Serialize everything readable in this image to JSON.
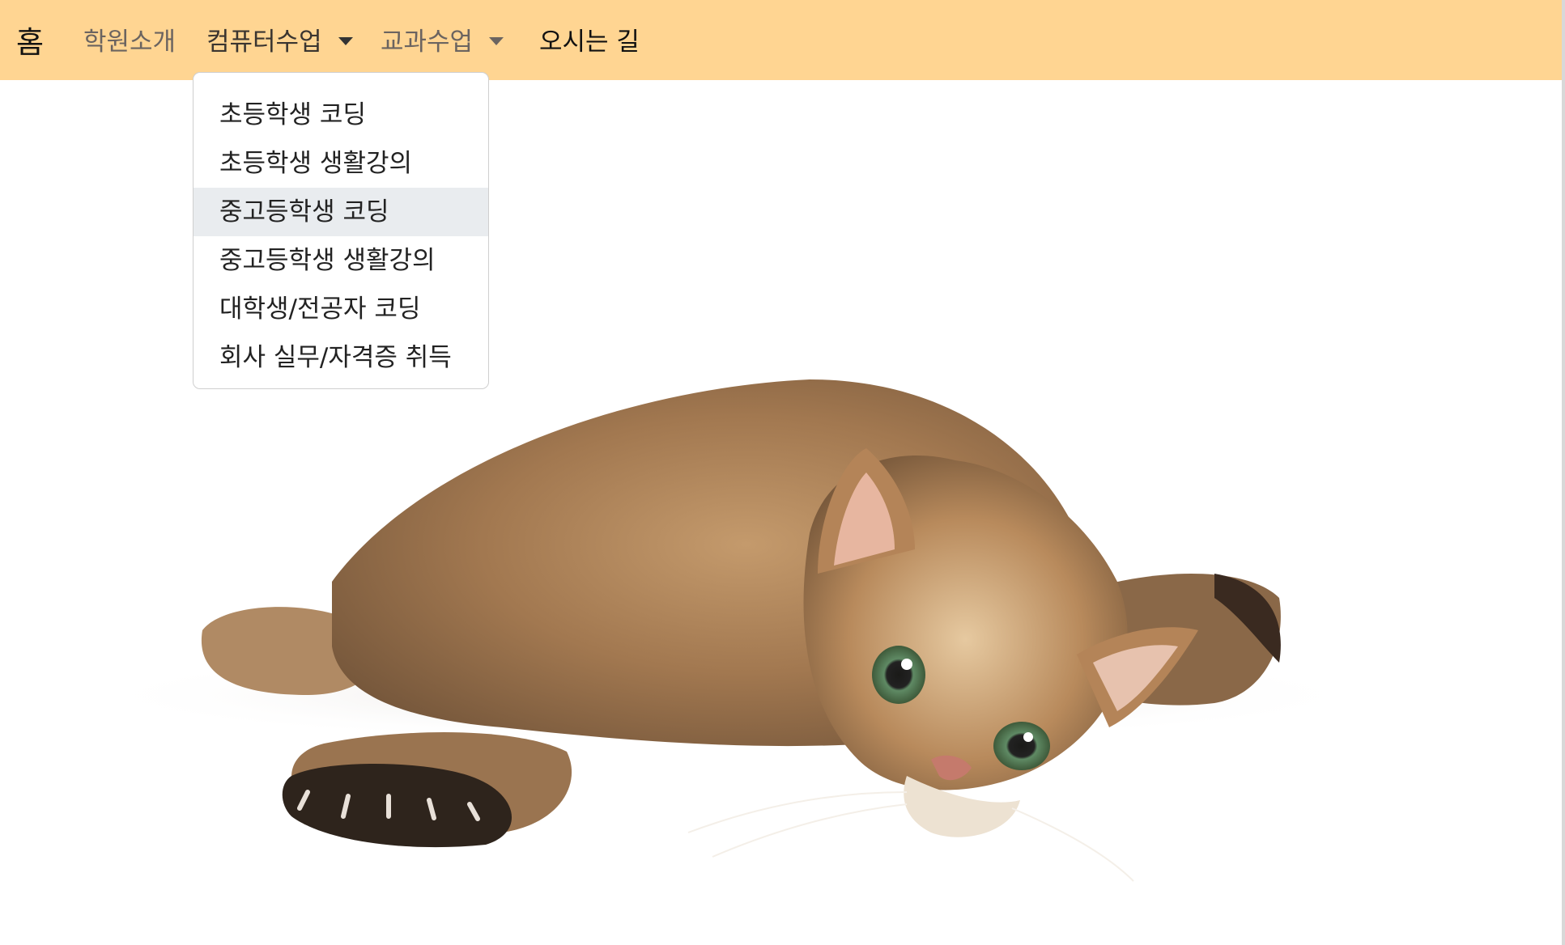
{
  "navbar": {
    "bg_color": "#ffd592",
    "brand": "홈",
    "items": [
      {
        "label": "학원소개"
      },
      {
        "label": "컴퓨터수업",
        "dropdown": true
      },
      {
        "label": "교과수업",
        "dropdown": true
      },
      {
        "label": "오시는 길"
      }
    ]
  },
  "dropdown": {
    "items": [
      {
        "label": "초등학생 코딩"
      },
      {
        "label": "초등학생 생활강의"
      },
      {
        "label": "중고등학생 코딩",
        "highlighted": true
      },
      {
        "label": "중고등학생 생활강의"
      },
      {
        "label": "대학생/전공자 코딩"
      },
      {
        "label": "회사 실무/자격증 취득"
      }
    ],
    "highlight_color": "#e9ecef"
  },
  "hero": {
    "image": "cat-lying-photo",
    "background": "#ffffff"
  }
}
